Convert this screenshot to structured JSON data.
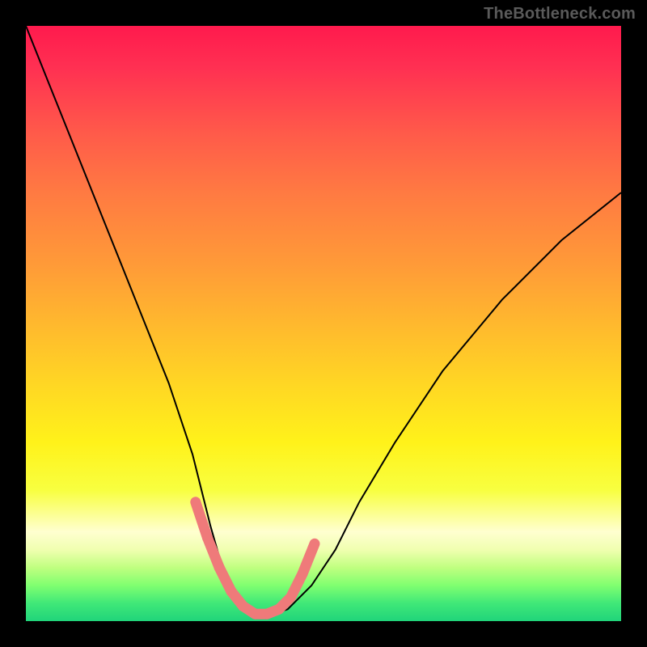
{
  "watermark": "TheBottleneck.com",
  "colors": {
    "frame": "#000000",
    "watermark_text": "#5a5a5a",
    "curve": "#000000",
    "marker": "#ef7a7a",
    "gradient_top": "#ff1a4d",
    "gradient_mid": "#fff21a",
    "gradient_bottom": "#20d47a"
  },
  "chart_data": {
    "type": "line",
    "title": "",
    "xlabel": "",
    "ylabel": "",
    "xlim": [
      0,
      100
    ],
    "ylim": [
      0,
      100
    ],
    "grid": false,
    "note": "Axes are normalized (no visible tick labels in image). Curve shows a V-shaped bottleneck dip; values estimated from pixel positions.",
    "series": [
      {
        "name": "bottleneck-curve",
        "x": [
          0,
          4,
          8,
          12,
          16,
          20,
          24,
          28,
          31,
          33,
          35,
          37,
          39,
          41,
          44,
          48,
          52,
          56,
          62,
          70,
          80,
          90,
          100
        ],
        "values": [
          100,
          90,
          80,
          70,
          60,
          50,
          40,
          28,
          16,
          9,
          4,
          2,
          1,
          1,
          2,
          6,
          12,
          20,
          30,
          42,
          54,
          64,
          72
        ]
      }
    ],
    "markers": {
      "name": "highlighted-range",
      "x": [
        28.5,
        30.5,
        32.5,
        34.5,
        36.5,
        38.5,
        40.5,
        42.5,
        44.5,
        46.5,
        48.5
      ],
      "values": [
        20.0,
        14.0,
        9.0,
        5.0,
        2.5,
        1.2,
        1.2,
        2.0,
        4.0,
        8.0,
        13.0
      ]
    }
  }
}
